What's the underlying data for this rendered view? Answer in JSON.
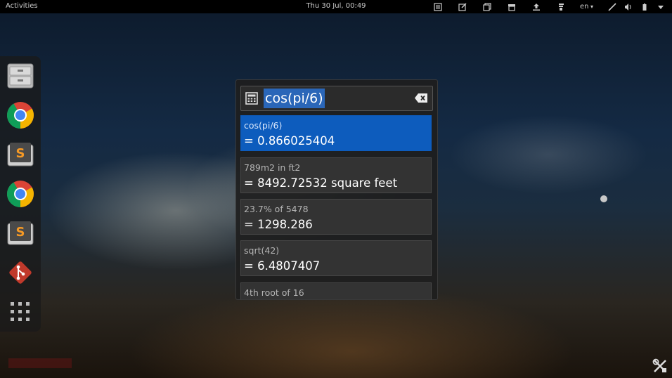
{
  "topbar": {
    "activities_label": "Activities",
    "clock": "Thu 30 Jul, 00:49",
    "language": "en",
    "tray_icons": [
      "notes-icon",
      "edit-icon",
      "copy-icon",
      "archive-icon",
      "upload-icon",
      "book-icon",
      "pen-icon",
      "volume-icon",
      "battery-icon",
      "menu-arrow-icon"
    ]
  },
  "dash": {
    "items": [
      "file-manager-icon",
      "chrome-icon",
      "sublime-text-icon",
      "chrome-icon",
      "sublime-text-icon",
      "git-icon",
      "app-grid-icon"
    ]
  },
  "search": {
    "query": "cos(pi/6)",
    "results": [
      {
        "expression": "cos(pi/6)",
        "value": "= 0.866025404",
        "selected": true
      },
      {
        "expression": "789m2 in ft2",
        "value": "= 8492.72532 square feet",
        "selected": false
      },
      {
        "expression": "23.7% of 5478",
        "value": "= 1298.286",
        "selected": false
      },
      {
        "expression": "sqrt(42)",
        "value": "= 6.4807407",
        "selected": false
      },
      {
        "expression": "4th root of 16",
        "value": "",
        "selected": false
      }
    ]
  },
  "colors": {
    "selection": "#0d5cbd",
    "text_highlight": "#2a66b8",
    "topbar": "#000000"
  }
}
